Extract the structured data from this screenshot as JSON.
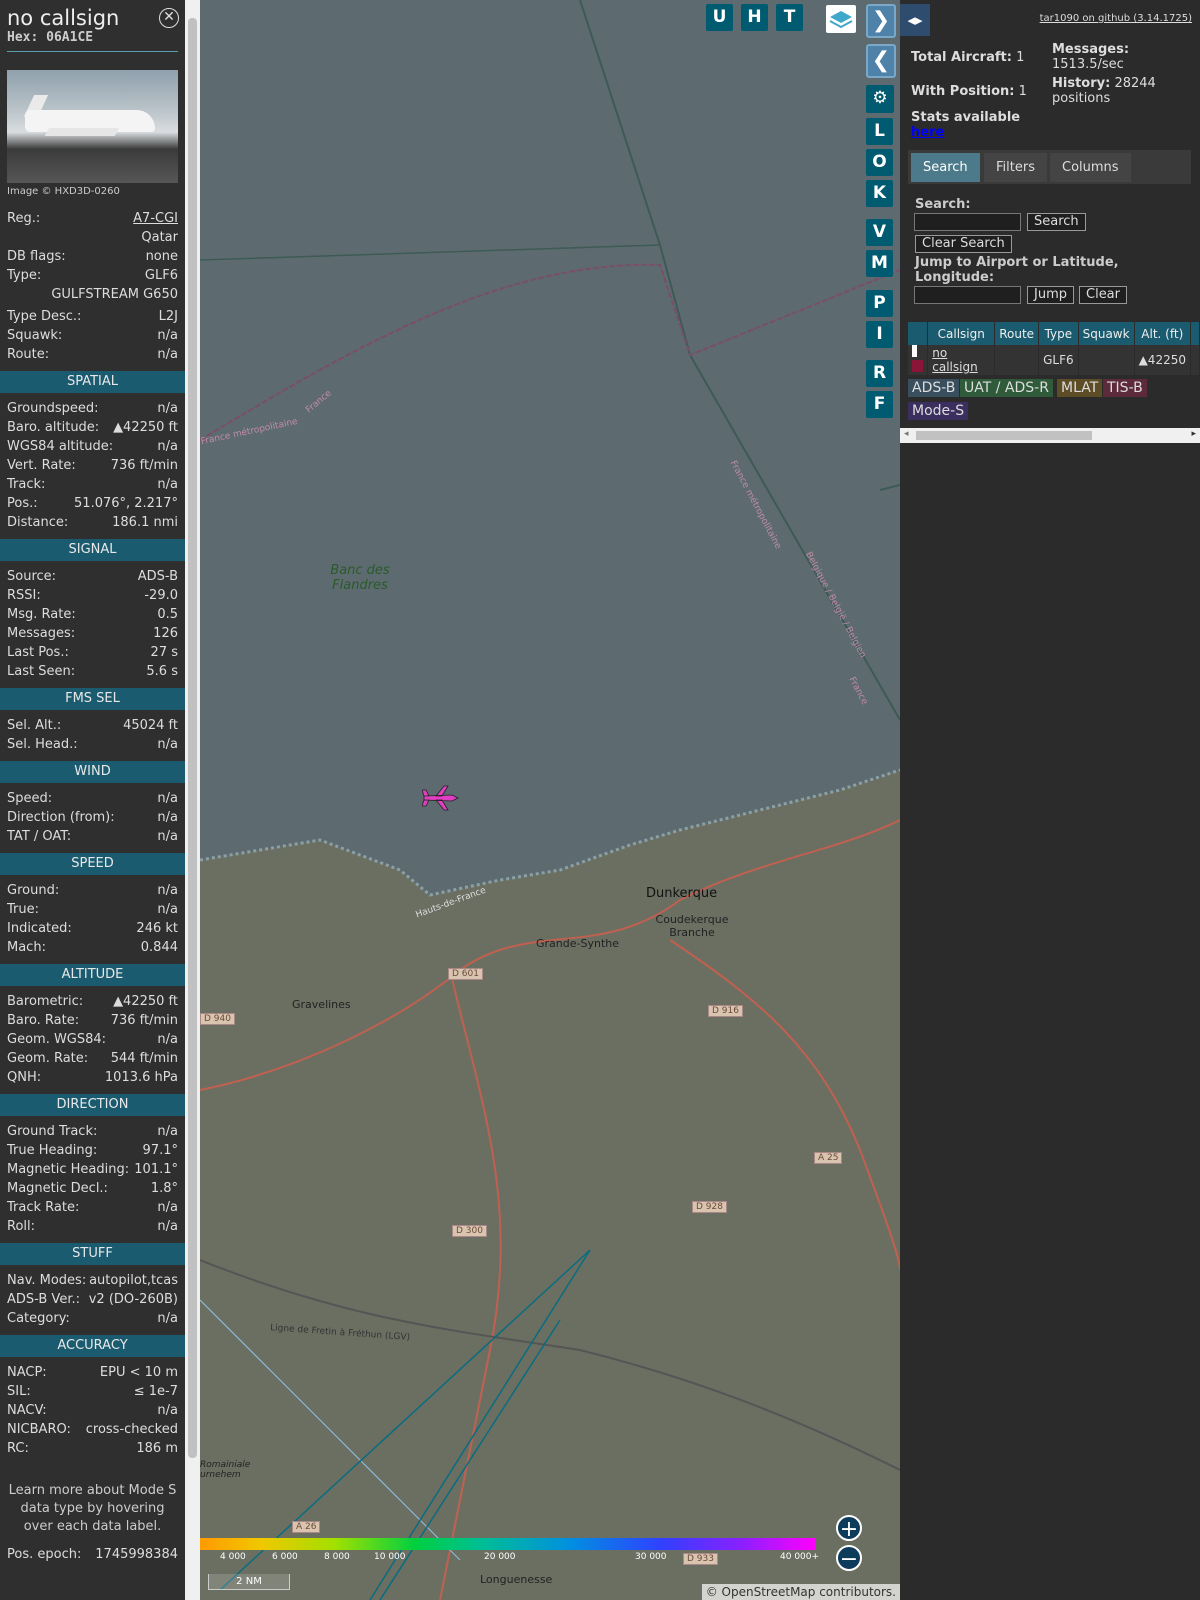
{
  "info": {
    "callsign": "no callsign",
    "hex": "Hex: 06A1CE",
    "photo_credit": "Image © HXD3D-0260",
    "reg_label": "Reg.:",
    "reg_value": "A7-CGI",
    "country": "Qatar",
    "dbflags_label": "DB flags:",
    "dbflags_value": "none",
    "type_label": "Type:",
    "type_value": "GLF6",
    "type_name": "GULFSTREAM G650",
    "typedesc_label": "Type Desc.:",
    "typedesc_value": "L2J",
    "squawk_label": "Squawk:",
    "squawk_value": "n/a",
    "route_label": "Route:",
    "route_value": "n/a",
    "sections": {
      "spatial": "SPATIAL",
      "signal": "SIGNAL",
      "fms": "FMS SEL",
      "wind": "WIND",
      "speed": "SPEED",
      "altitude": "ALTITUDE",
      "direction": "DIRECTION",
      "stuff": "STUFF",
      "accuracy": "ACCURACY"
    },
    "spatial": [
      {
        "k": "Groundspeed:",
        "v": "n/a"
      },
      {
        "k": "Baro. altitude:",
        "v": "▲42250 ft"
      },
      {
        "k": "WGS84 altitude:",
        "v": "n/a"
      },
      {
        "k": "Vert. Rate:",
        "v": "736 ft/min"
      },
      {
        "k": "Track:",
        "v": "n/a"
      },
      {
        "k": "Pos.:",
        "v": "51.076°, 2.217°"
      },
      {
        "k": "Distance:",
        "v": "186.1 nmi"
      }
    ],
    "signal": [
      {
        "k": "Source:",
        "v": "ADS-B"
      },
      {
        "k": "RSSI:",
        "v": "-29.0"
      },
      {
        "k": "Msg. Rate:",
        "v": "0.5"
      },
      {
        "k": "Messages:",
        "v": "126"
      },
      {
        "k": "Last Pos.:",
        "v": "27 s"
      },
      {
        "k": "Last Seen:",
        "v": "5.6 s"
      }
    ],
    "fms": [
      {
        "k": "Sel. Alt.:",
        "v": "45024 ft"
      },
      {
        "k": "Sel. Head.:",
        "v": "n/a"
      }
    ],
    "wind": [
      {
        "k": "Speed:",
        "v": "n/a"
      },
      {
        "k": "Direction (from):",
        "v": "n/a"
      },
      {
        "k": "TAT / OAT:",
        "v": "n/a"
      }
    ],
    "speed": [
      {
        "k": "Ground:",
        "v": "n/a"
      },
      {
        "k": "True:",
        "v": "n/a"
      },
      {
        "k": "Indicated:",
        "v": "246 kt"
      },
      {
        "k": "Mach:",
        "v": "0.844"
      }
    ],
    "altitude": [
      {
        "k": "Barometric:",
        "v": "▲42250 ft"
      },
      {
        "k": "Baro. Rate:",
        "v": "736 ft/min"
      },
      {
        "k": "Geom. WGS84:",
        "v": "n/a"
      },
      {
        "k": "Geom. Rate:",
        "v": "544 ft/min"
      },
      {
        "k": "QNH:",
        "v": "1013.6 hPa"
      }
    ],
    "direction": [
      {
        "k": "Ground Track:",
        "v": "n/a"
      },
      {
        "k": "True Heading:",
        "v": "97.1°"
      },
      {
        "k": "Magnetic Heading:",
        "v": "101.1°"
      },
      {
        "k": "Magnetic Decl.:",
        "v": "1.8°"
      },
      {
        "k": "Track Rate:",
        "v": "n/a"
      },
      {
        "k": "Roll:",
        "v": "n/a"
      }
    ],
    "stuff": [
      {
        "k": "Nav. Modes:",
        "v": "autopilot,tcas"
      },
      {
        "k": "ADS-B Ver.:",
        "v": "v2 (DO-260B)"
      },
      {
        "k": "Category:",
        "v": "n/a"
      }
    ],
    "accuracy": [
      {
        "k": "NACP:",
        "v": "EPU < 10 m"
      },
      {
        "k": "SIL:",
        "v": "≤ 1e-7"
      },
      {
        "k": "NACV:",
        "v": "n/a"
      },
      {
        "k": "NICBARO:",
        "v": "cross-checked"
      },
      {
        "k": "RC:",
        "v": "186 m"
      }
    ],
    "note": "Learn more about Mode S data type by hovering over each data label.",
    "epoch_label": "Pos. epoch:",
    "epoch_value": "1745998384"
  },
  "map": {
    "buttons_top": [
      "U",
      "H",
      "T"
    ],
    "buttons_side": [
      "L",
      "O",
      "K",
      "V",
      "M",
      "P",
      "I",
      "R",
      "F"
    ],
    "labels": {
      "banc": "Banc des Flandres",
      "dunkerque": "Dunkerque",
      "coudekerque": "Coudekerque Branche",
      "grande_synthe": "Grande-Synthe",
      "gravelines": "Gravelines",
      "longuenesse": "Longuenesse",
      "france_metro": "France métropolitaine",
      "france": "France",
      "belgique": "Belgique / België / Belgien",
      "france_metro2": "France métropolitaine",
      "france2": "France",
      "hauts": "Hauts-de-France",
      "ligne": "Ligne de Fretin à Fréthun (LGV)",
      "romainiale": "Romainiale urnehem"
    },
    "roads": [
      "D 601",
      "D 940",
      "D 916",
      "A 25",
      "D 928",
      "D 300",
      "A 26",
      "D 933"
    ],
    "alt_scale": [
      "4 000",
      "6 000",
      "8 000",
      "10 000",
      "20 000",
      "30 000",
      "40 000+"
    ],
    "scale": "2 NM",
    "attribution": "© OpenStreetMap contributors."
  },
  "sidebar": {
    "github": "tar1090 on github (3.14.1725)",
    "total_label": "Total Aircraft:",
    "total_value": "1",
    "withpos_label": "With Position:",
    "withpos_value": "1",
    "stats_label": "Stats available",
    "stats_link": "here",
    "messages_label": "Messages:",
    "messages_value": "1513.5/sec",
    "history_label": "History:",
    "history_value": "28244 positions",
    "tabs": [
      "Search",
      "Filters",
      "Columns"
    ],
    "search_label": "Search:",
    "search_btn": "Search",
    "clear_search_btn": "Clear Search",
    "jump_label": "Jump to Airport or Latitude, Longitude:",
    "jump_btn": "Jump",
    "clear_btn": "Clear",
    "table_headers": [
      "Callsign",
      "Route",
      "Type",
      "Squawk",
      "Alt. (ft)"
    ],
    "row": {
      "callsign": "no callsign",
      "route": "",
      "type": "GLF6",
      "squawk": "",
      "alt": "▲42250"
    },
    "legend": [
      "ADS-B",
      "UAT / ADS-R",
      "MLAT",
      "TIS-B",
      "Mode-S"
    ],
    "legend_colors": [
      "#3a4f5e",
      "#2f5b3a",
      "#5c4d26",
      "#5d2a3c",
      "#3a2f5e"
    ]
  }
}
